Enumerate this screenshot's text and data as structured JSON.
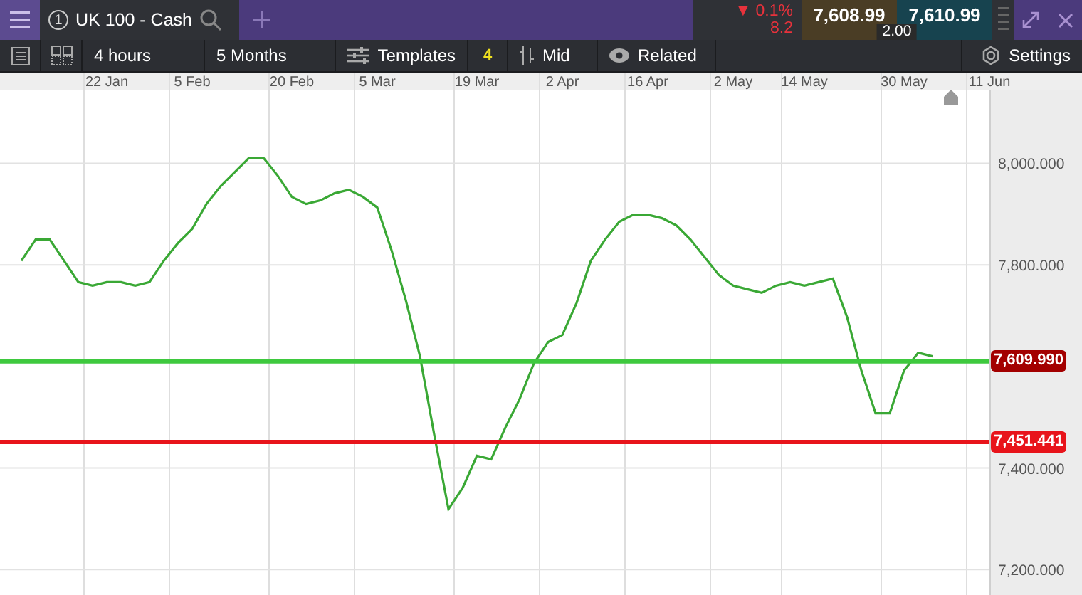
{
  "header": {
    "tab": {
      "number": "1",
      "title": "UK 100 - Cash"
    },
    "quote": {
      "change": "▼ 0.1%",
      "change_points": "8.2",
      "sell": "7,608.99",
      "buy": "7,610.99",
      "spread": "2.00"
    }
  },
  "toolbar": {
    "interval": "4 hours",
    "range": "5 Months",
    "templates": {
      "label": "Templates",
      "badge": "4"
    },
    "price_type": "Mid",
    "related": "Related",
    "settings": "Settings"
  },
  "chart": {
    "chart_data": {
      "type": "line",
      "grid": true,
      "categories": [
        null,
        null,
        null,
        null,
        null,
        null,
        "22 Jan",
        null,
        null,
        null,
        null,
        null,
        "5 Feb",
        null,
        null,
        null,
        null,
        null,
        null,
        "20 Feb",
        null,
        null,
        null,
        null,
        null,
        "5 Mar",
        null,
        null,
        null,
        null,
        null,
        null,
        "19 Mar",
        null,
        null,
        null,
        null,
        null,
        "2 Apr",
        null,
        null,
        null,
        null,
        null,
        "16 Apr",
        null,
        null,
        null,
        null,
        null,
        "2 May",
        null,
        null,
        null,
        null,
        "14 May",
        null,
        null,
        null,
        null,
        null,
        null,
        "30 May",
        null,
        null,
        null,
        null,
        null,
        "11 Jun"
      ],
      "series": [
        {
          "color": "#3aa835",
          "values": [
            7808,
            7850,
            7850,
            7808,
            7766,
            7759,
            7766,
            7766,
            7759,
            7766,
            7808,
            7843,
            7871,
            7920,
            7955,
            7983,
            8011,
            8011,
            7976,
            7934,
            7920,
            7927,
            7941,
            7948,
            7934,
            7913,
            7829,
            7731,
            7620,
            7466,
            7319,
            7361,
            7424,
            7417,
            7480,
            7536,
            7606,
            7648,
            7662,
            7725,
            7808,
            7850,
            7885,
            7899,
            7899,
            7892,
            7878,
            7850,
            7815,
            7780,
            7759,
            7752,
            7745,
            7759,
            7766,
            7759,
            7766,
            7773,
            7697,
            7592,
            7508,
            7508,
            7592,
            7627,
            7620,
            null,
            null,
            null,
            null
          ]
        }
      ],
      "ylim": [
        7150,
        8145
      ],
      "yticks": [
        {
          "value": 8000,
          "label": "8,000.000"
        },
        {
          "value": 7800,
          "label": "7,800.000"
        },
        {
          "value": 7400,
          "label": "7,400.000"
        },
        {
          "value": 7200,
          "label": "7,200.000"
        }
      ],
      "ref_lines": [
        {
          "axis": "y",
          "value": 7609.99,
          "label": "7,609.990",
          "color": "#3ec93e"
        },
        {
          "axis": "y",
          "value": 7451.441,
          "label": "7,451.441",
          "color": "#e8141b"
        }
      ]
    },
    "price_tags": [
      {
        "color": "#a30000"
      },
      {
        "color": "#e8141b"
      }
    ]
  }
}
